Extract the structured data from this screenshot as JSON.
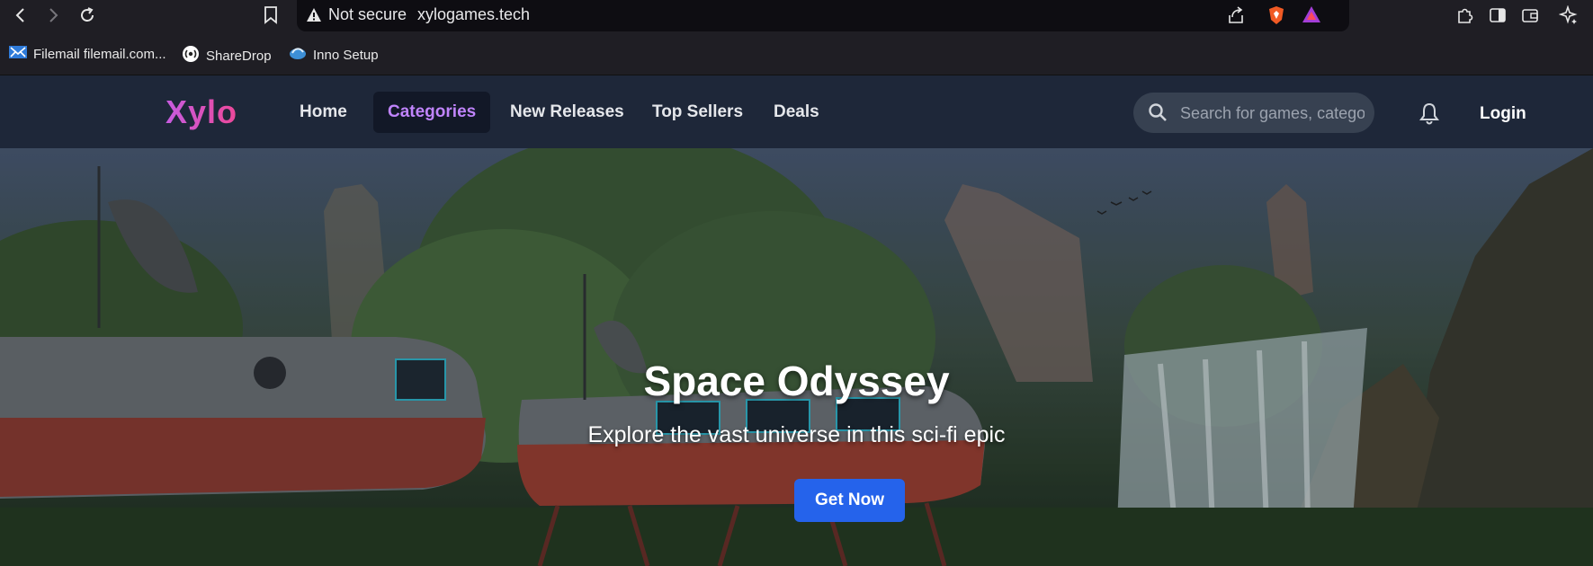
{
  "browser": {
    "security_label": "Not secure",
    "url": "xylogames.tech",
    "icons": [
      "back-icon",
      "forward-icon",
      "reload-icon",
      "bookmark-icon",
      "warning-icon",
      "share-icon",
      "brave-shields-icon",
      "brave-rewards-icon",
      "extensions-icon",
      "sidebar-icon",
      "wallet-icon",
      "leo-ai-icon"
    ]
  },
  "bookmarks": [
    {
      "label": "Filemail filemail.com...",
      "icon": "filemail-icon"
    },
    {
      "label": "ShareDrop",
      "icon": "sharedrop-icon"
    },
    {
      "label": "Inno Setup",
      "icon": "inno-setup-icon"
    }
  ],
  "site": {
    "logo": "Xylo",
    "nav": [
      "Home",
      "Categories",
      "New Releases",
      "Top Sellers",
      "Deals"
    ],
    "active_nav": "Categories",
    "search_placeholder": "Search for games, categories...",
    "login": "Login"
  },
  "hero": {
    "title": "Space Odyssey",
    "subtitle": "Explore the vast universe in this sci-fi epic",
    "cta": "Get Now"
  },
  "colors": {
    "header_bg": "#1e2739",
    "accent_purple": "#c084fc",
    "cta_blue": "#2563eb"
  }
}
